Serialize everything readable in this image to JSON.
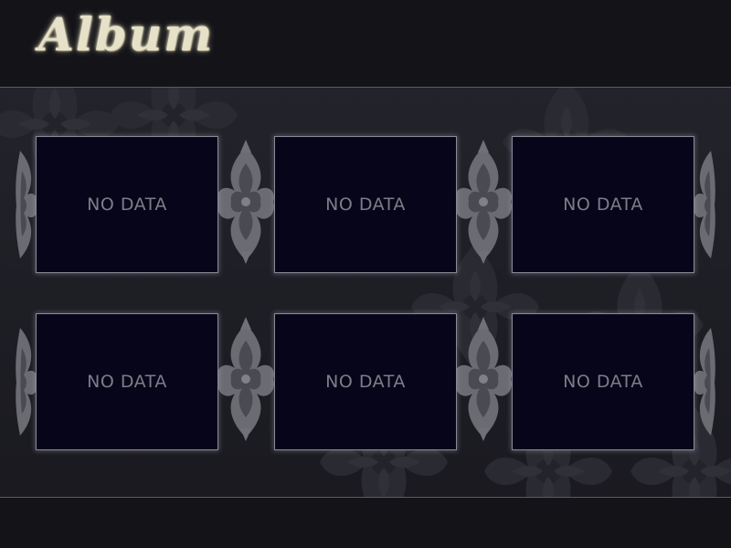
{
  "header": {
    "title": "Album"
  },
  "album": {
    "slots": [
      {
        "label": "NO DATA"
      },
      {
        "label": "NO DATA"
      },
      {
        "label": "NO DATA"
      },
      {
        "label": "NO DATA"
      },
      {
        "label": "NO DATA"
      },
      {
        "label": "NO DATA"
      }
    ]
  },
  "colors": {
    "background": "#131318",
    "band": "#1e1e25",
    "slot_fill": "#06051a",
    "slot_border": "#8a8a96",
    "label_text": "#7d7d86",
    "title_text": "#e6e2c9",
    "ornament": "#6e6e74"
  }
}
